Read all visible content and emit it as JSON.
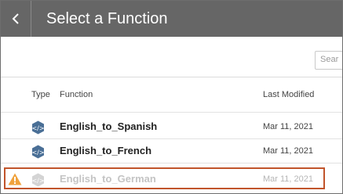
{
  "header": {
    "title": "Select a Function",
    "back_icon": "chevron-left-icon",
    "background_color": "#666666"
  },
  "search": {
    "placeholder": "Sear"
  },
  "table": {
    "columns": {
      "type": "Type",
      "function": "Function",
      "last_modified": "Last Modified"
    },
    "rows": [
      {
        "name": "English_to_Spanish",
        "last_modified": "Mar 11, 2021",
        "icon": "code-function-icon",
        "state": "normal"
      },
      {
        "name": "English_to_French",
        "last_modified": "Mar 11, 2021",
        "icon": "code-function-icon",
        "state": "normal"
      },
      {
        "name": "English_to_German",
        "last_modified": "Mar 11, 2021",
        "icon": "code-function-icon",
        "state": "disabled",
        "warning_icon": "warning-icon",
        "highlight_color": "#c1542b"
      }
    ]
  },
  "colors": {
    "icon_blue": "#4a6f96",
    "warning": "#f0a23c"
  }
}
